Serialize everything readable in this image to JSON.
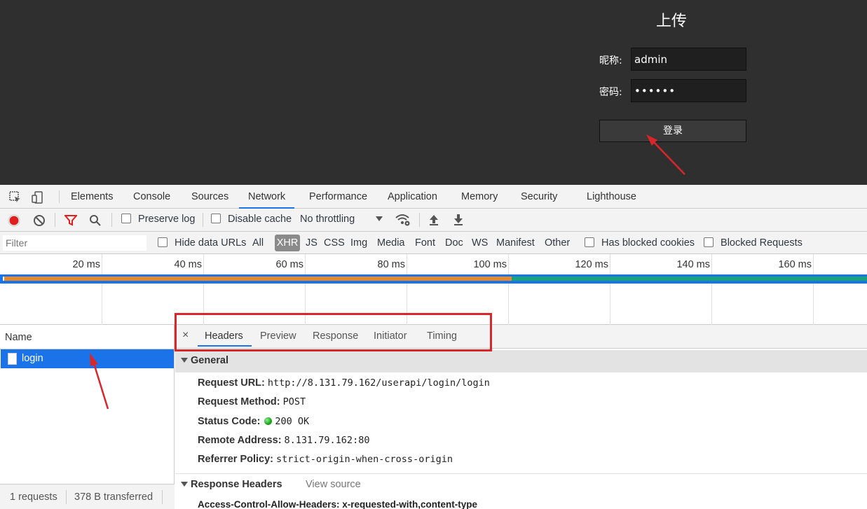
{
  "page": {
    "title": "上传",
    "nickname_label": "昵称:",
    "nickname_value": "admin",
    "password_label": "密码:",
    "password_value": "••••••",
    "login_button": "登录"
  },
  "devtools": {
    "tabs": [
      "Elements",
      "Console",
      "Sources",
      "Network",
      "Performance",
      "Application",
      "Memory",
      "Security",
      "Lighthouse"
    ],
    "active_tab": "Network",
    "toolbar": {
      "preserve_log": "Preserve log",
      "disable_cache": "Disable cache",
      "throttling": "No throttling"
    },
    "filterbar": {
      "filter_placeholder": "Filter",
      "hide_data_urls": "Hide data URLs",
      "types": [
        "All",
        "XHR",
        "JS",
        "CSS",
        "Img",
        "Media",
        "Font",
        "Doc",
        "WS",
        "Manifest",
        "Other"
      ],
      "active_type": "XHR",
      "has_blocked_cookies": "Has blocked cookies",
      "blocked_requests": "Blocked Requests"
    },
    "timeline_ticks": [
      "20 ms",
      "40 ms",
      "60 ms",
      "80 ms",
      "100 ms",
      "120 ms",
      "140 ms",
      "160 ms"
    ],
    "requests": {
      "column_name": "Name",
      "rows": [
        "login"
      ],
      "footer_count": "1 requests",
      "footer_transferred": "378 B transferred"
    },
    "detail": {
      "close": "×",
      "tabs": [
        "Headers",
        "Preview",
        "Response",
        "Initiator",
        "Timing"
      ],
      "active_tab": "Headers",
      "general": {
        "title": "General",
        "request_url_label": "Request URL:",
        "request_url": "http://8.131.79.162/userapi/login/login",
        "request_method_label": "Request Method:",
        "request_method": "POST",
        "status_code_label": "Status Code:",
        "status_code": "200 OK",
        "remote_address_label": "Remote Address:",
        "remote_address": "8.131.79.162:80",
        "referrer_policy_label": "Referrer Policy:",
        "referrer_policy": "strict-origin-when-cross-origin"
      },
      "response_headers": {
        "title": "Response Headers",
        "view_source": "View source",
        "partial_row": "Access-Control-Allow-Headers: x-requested-with,content-type"
      }
    }
  },
  "colors": {
    "page_bg": "#2f2f2f",
    "active_blue": "#1a73e8",
    "annotation_red": "#d9262b",
    "bar_orange": "#e8892b",
    "bar_green": "#1aa37a"
  }
}
